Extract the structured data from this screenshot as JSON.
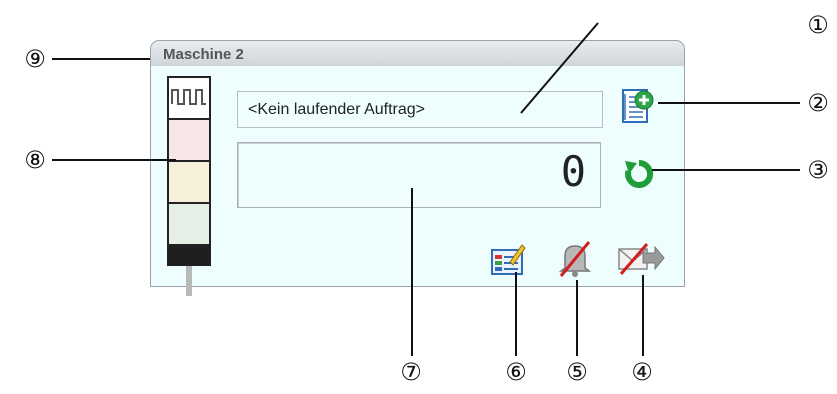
{
  "window": {
    "title": "Maschine 2"
  },
  "order": {
    "text": "<Kein laufender Auftrag>"
  },
  "counter": {
    "value": "0"
  },
  "callouts": {
    "c1": "①",
    "c2": "②",
    "c3": "③",
    "c4": "④",
    "c5": "⑤",
    "c6": "⑥",
    "c7": "⑦",
    "c8": "⑧",
    "c9": "⑨"
  },
  "icons": {
    "add_order": "add-order-icon",
    "reset": "reset-counter-icon",
    "mail_disabled": "mail-disabled-icon",
    "alarm_disabled": "alarm-disabled-icon",
    "edit_settings": "edit-settings-icon",
    "signal_light": "signal-light-icon"
  },
  "colors": {
    "panel_bg": "#eefdfd",
    "reset_green": "#1f9d38",
    "disabled_red": "#d21e1e"
  }
}
